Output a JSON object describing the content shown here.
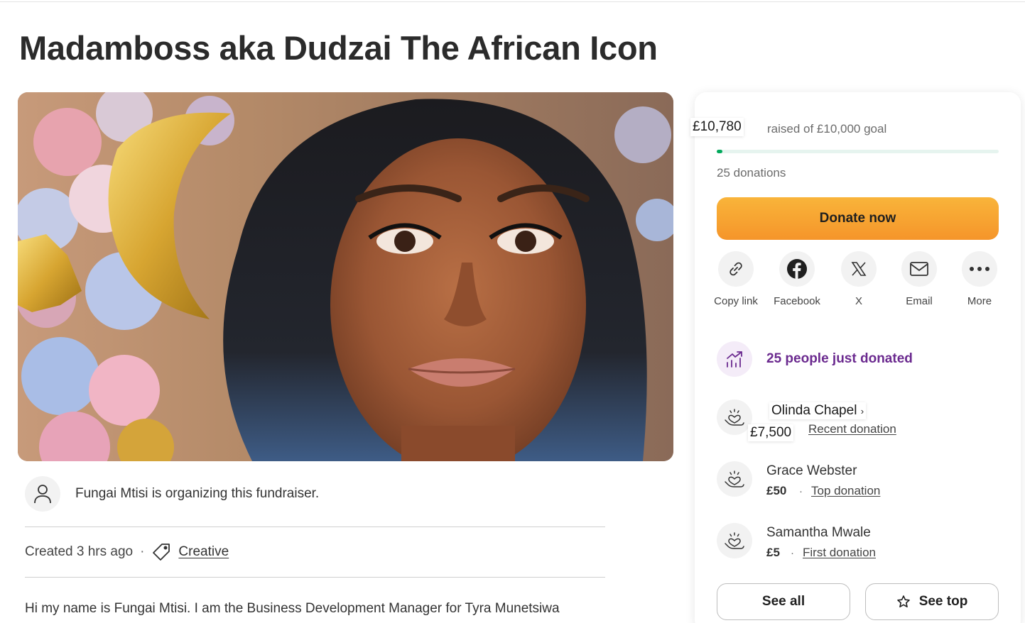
{
  "page": {
    "title": "Madamboss aka Dudzai The African Icon"
  },
  "organizer": {
    "text": "Fungai Mtisi is organizing this fundraiser.",
    "icon": "person-icon"
  },
  "meta": {
    "created": "Created 3 hrs ago",
    "separator": "·",
    "category": "Creative",
    "icon": "tag-icon"
  },
  "story": {
    "first_line": "Hi my name is Fungai Mtisi. I am the Business Development Manager for Tyra Munetsiwa"
  },
  "fundraiser": {
    "raised": "£10,780",
    "goal_text": "raised of £10,000 goal",
    "progress_fraction": 0.02,
    "donations_count": "25 donations",
    "donate_label": "Donate now",
    "accent_color": "#02a95c",
    "donate_color": "#f5952a"
  },
  "share": [
    {
      "label": "Copy link",
      "icon": "link-icon"
    },
    {
      "label": "Facebook",
      "icon": "facebook-icon"
    },
    {
      "label": "X",
      "icon": "x-icon"
    },
    {
      "label": "Email",
      "icon": "email-icon"
    },
    {
      "label": "More",
      "icon": "more-icon"
    }
  ],
  "recent_activity": {
    "text": "25 people just donated",
    "icon": "trending-up-icon",
    "color": "#6b2a8f"
  },
  "donors": [
    {
      "name": "Olinda Chapel",
      "amount": "£7,500",
      "tag": "Recent donation",
      "icon": "heart-hands-icon"
    },
    {
      "name": "Grace Webster",
      "amount": "£50",
      "tag": "Top donation",
      "icon": "heart-hands-icon"
    },
    {
      "name": "Samantha Mwale",
      "amount": "£5",
      "tag": "First donation",
      "icon": "heart-hands-icon"
    }
  ],
  "donor_separator": "·",
  "buttons": {
    "see_all": "See all",
    "see_top": "See top"
  }
}
